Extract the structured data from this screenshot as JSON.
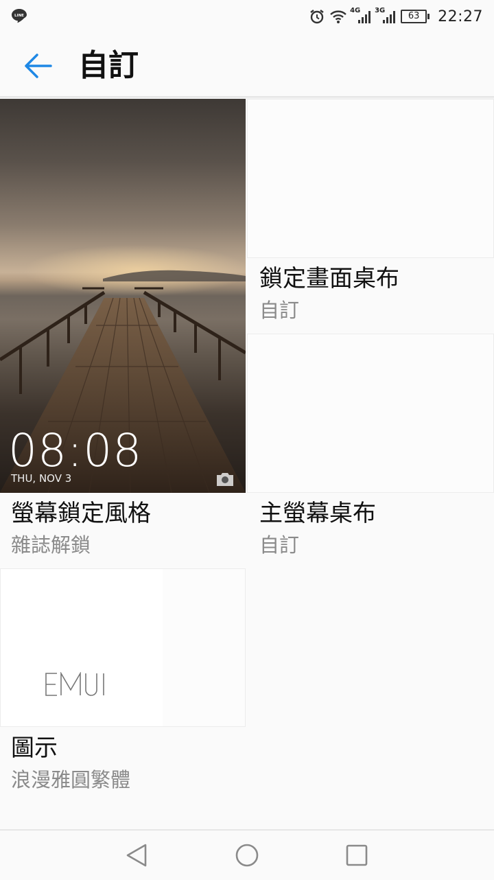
{
  "status_bar": {
    "time": "22:27",
    "battery": "63",
    "net1": "4G",
    "net2": "3G",
    "icons": [
      "line-icon",
      "alarm-icon",
      "wifi-icon",
      "signal-icon",
      "signal-icon",
      "battery-icon"
    ]
  },
  "action_bar": {
    "title": "自訂",
    "back_icon": "arrow-left-icon"
  },
  "tiles": {
    "lock_style": {
      "title": "螢幕鎖定風格",
      "subtitle": "雜誌解鎖",
      "preview_time": "08:08",
      "preview_date": "THU, NOV 3"
    },
    "lock_wallpaper": {
      "title": "鎖定畫面桌布",
      "subtitle": "自訂"
    },
    "home_wallpaper": {
      "title": "主螢幕桌布",
      "subtitle": "自訂"
    },
    "icons": {
      "title": "圖示",
      "subtitle": "浪漫雅圓繁體",
      "logo_text": "EMUI"
    }
  },
  "nav_bar": {
    "icons": [
      "back-triangle-icon",
      "home-circle-icon",
      "recents-square-icon"
    ]
  },
  "colors": {
    "accent": "#1e88e5",
    "background": "#fafafa",
    "subtitle": "#8a8a8a"
  }
}
